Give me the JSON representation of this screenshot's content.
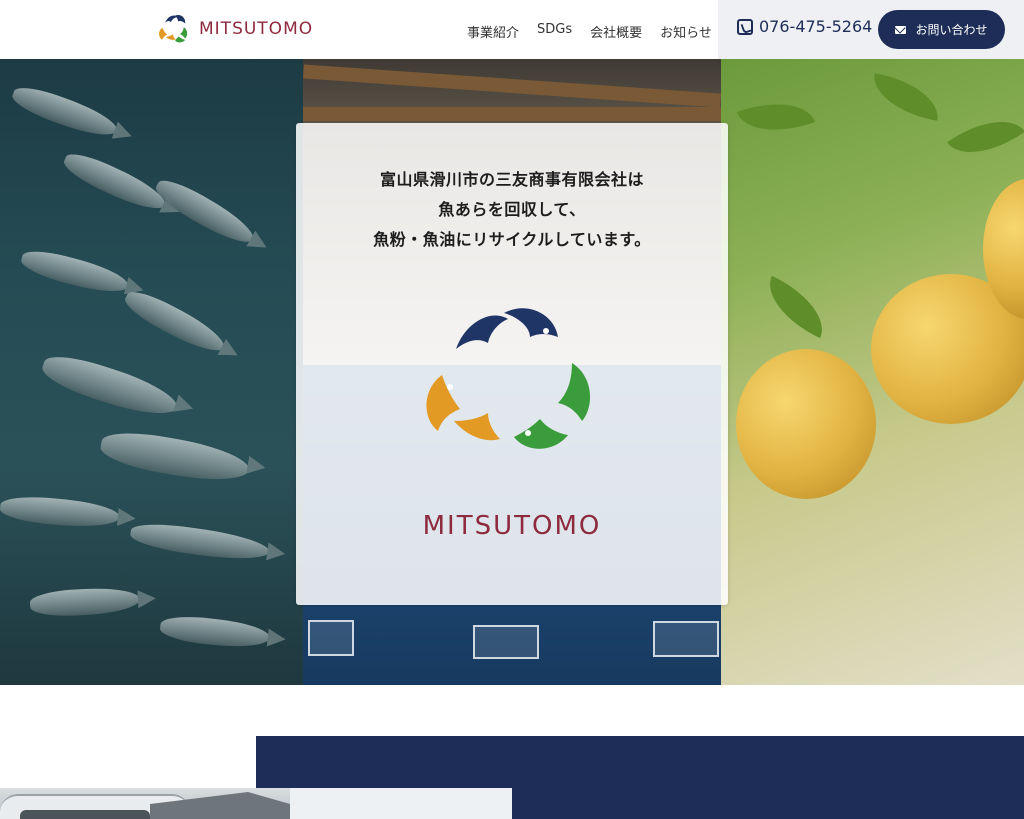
{
  "header": {
    "brand": "MITSUTOMO",
    "nav": [
      "事業紹介",
      "SDGs",
      "会社概要",
      "お知らせ"
    ],
    "phone": "076-475-5264",
    "contact_label": "お問い合わせ"
  },
  "hero": {
    "tagline_lines": [
      "富山県滑川市の三友商事有限会社は",
      "魚あらを回収して、",
      "魚粉・魚油にリサイクルしています。"
    ],
    "logo_text": "MITSUTOMO"
  },
  "colors": {
    "brand_navy": "#1e2d57",
    "brand_red": "#8e2a3e",
    "logo_orange": "#e29a25",
    "logo_green": "#3a9c3a",
    "logo_navy": "#1f3566"
  },
  "icons": [
    "phone-icon",
    "mail-icon",
    "recycle-fish-logo-icon"
  ]
}
